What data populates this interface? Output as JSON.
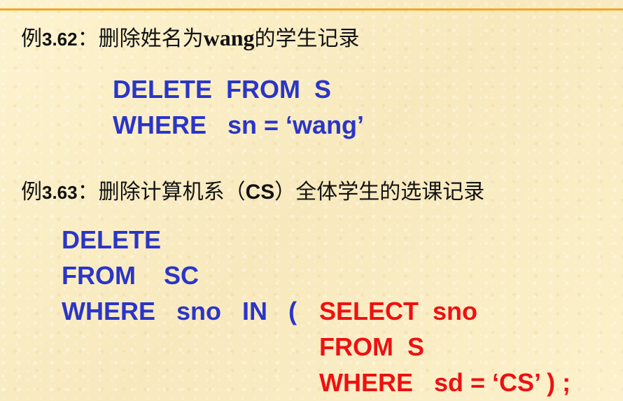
{
  "colors": {
    "background": "#fbf0c8",
    "rule": "#f5a623",
    "sql_keyword": "#2a35c8",
    "subquery": "#ee1111",
    "heading": "#111111"
  },
  "example1": {
    "label": "例",
    "number": "3.62",
    "colon": "：",
    "text_before": "删除姓名为",
    "highlight": "wang",
    "text_after": "的学生记录",
    "sql": {
      "line1": "DELETE  FROM  S",
      "line2": "WHERE   sn = ‘wang’"
    }
  },
  "example2": {
    "label": "例",
    "number": "3.63",
    "colon": "：",
    "text_before": "删除计算机系（",
    "highlight": "CS",
    "text_after": "）全体学生的选课记录",
    "sql": {
      "line1": "DELETE",
      "line2": "FROM    SC",
      "line3_main": "WHERE   sno   IN   (",
      "line3_sub": "SELECT  sno",
      "line4_sub": "FROM  S",
      "line5_sub": "WHERE   sd = ‘CS’ ) ;"
    }
  }
}
